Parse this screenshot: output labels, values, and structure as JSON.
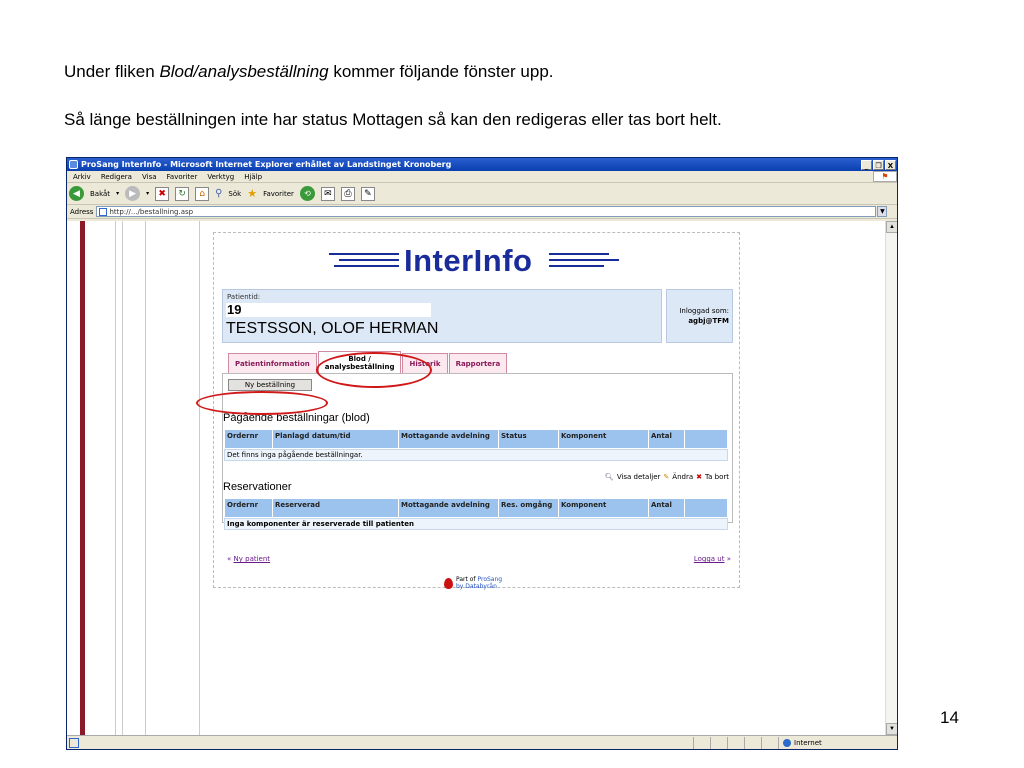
{
  "slide": {
    "line1_prefix": "Under fliken ",
    "line1_italic": "Blod/analysbeställning",
    "line1_suffix": " kommer följande fönster upp.",
    "line2": "Så länge beställningen inte har status Mottagen så kan den redigeras eller tas bort helt.",
    "page_number": "14"
  },
  "window": {
    "title": "ProSang InterInfo - Microsoft Internet Explorer erhållet av Landstinget Kronoberg",
    "buttons": [
      "_",
      "❒",
      "X"
    ]
  },
  "menu": [
    "Arkiv",
    "Redigera",
    "Visa",
    "Favoriter",
    "Verktyg",
    "Hjälp"
  ],
  "toolbar": {
    "back_label": "Bakåt",
    "search_label": "Sök",
    "favorites_label": "Favoriter"
  },
  "address": {
    "label": "Adress",
    "url": "http://.../bestallning.asp"
  },
  "statusbar": {
    "zone": "Internet"
  },
  "app": {
    "logo": "InterInfo",
    "patient_label": "Patientid:",
    "patient_id": "19",
    "patient_name": "TESTSSON, OLOF HERMAN",
    "login_label": "Inloggad som:",
    "login_user": "agbj@TFM",
    "tabs": [
      "Patientinformation",
      "Blod /",
      "analysbeställning",
      "Historik",
      "Rapportera"
    ],
    "new_order_button": "Ny beställning",
    "ongoing_title": "Pågående beställningar (blod)",
    "ongoing_headers": [
      "Ordernr",
      "Planlagd datum/tid",
      "Mottagande avdelning",
      "Status",
      "Komponent",
      "Antal",
      ""
    ],
    "ongoing_empty": "Det finns inga pågående beställningar.",
    "actions": {
      "details": "Visa detaljer",
      "edit": "Ändra",
      "delete": "Ta bort"
    },
    "reservations_title": "Reservationer",
    "reservations_headers": [
      "Ordernr",
      "Reserverad",
      "Mottagande avdelning",
      "Res. omgång",
      "Komponent",
      "Antal",
      ""
    ],
    "reservations_empty": "Inga komponenter är reserverade till patienten",
    "new_patient_link": "Ny patient",
    "logout_link": "Logga ut",
    "footer_part_of": "Part of",
    "footer_brand": "ProSang",
    "footer_by": "by Databyrån"
  }
}
